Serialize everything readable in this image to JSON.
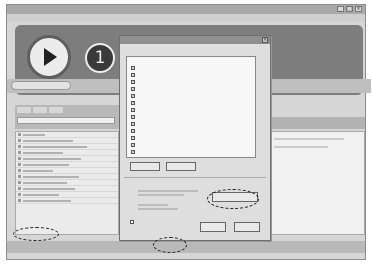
{
  "window": {
    "title": "",
    "buttons": [
      "_",
      "□",
      "×"
    ]
  },
  "menu": [],
  "player": {
    "track_number": "1"
  },
  "dialog": {
    "title": "",
    "close": "×",
    "section_label": "",
    "list_header": "",
    "items": [
      {
        "label": "",
        "checked": true
      },
      {
        "label": "",
        "checked": true
      },
      {
        "label": "",
        "checked": true
      },
      {
        "label": "",
        "checked": true
      },
      {
        "label": "",
        "checked": true
      },
      {
        "label": "",
        "checked": true
      },
      {
        "label": "",
        "checked": true
      },
      {
        "label": "",
        "checked": true
      },
      {
        "label": "",
        "checked": true
      },
      {
        "label": "",
        "checked": true
      },
      {
        "label": "",
        "checked": true
      },
      {
        "label": "",
        "checked": true
      },
      {
        "label": "",
        "checked": true
      }
    ],
    "select_all": "",
    "deselect_all": "",
    "folder_label": "",
    "change_button": "",
    "checkbox_label": "",
    "ok": "",
    "cancel": ""
  },
  "bottom_bar": [],
  "colors": {
    "hero": "#7d7d7d",
    "frame": "#d6d6d6",
    "dialog": "#dedede"
  },
  "icons": [
    "play-icon",
    "track-number-icon",
    "checkbox-icon"
  ]
}
